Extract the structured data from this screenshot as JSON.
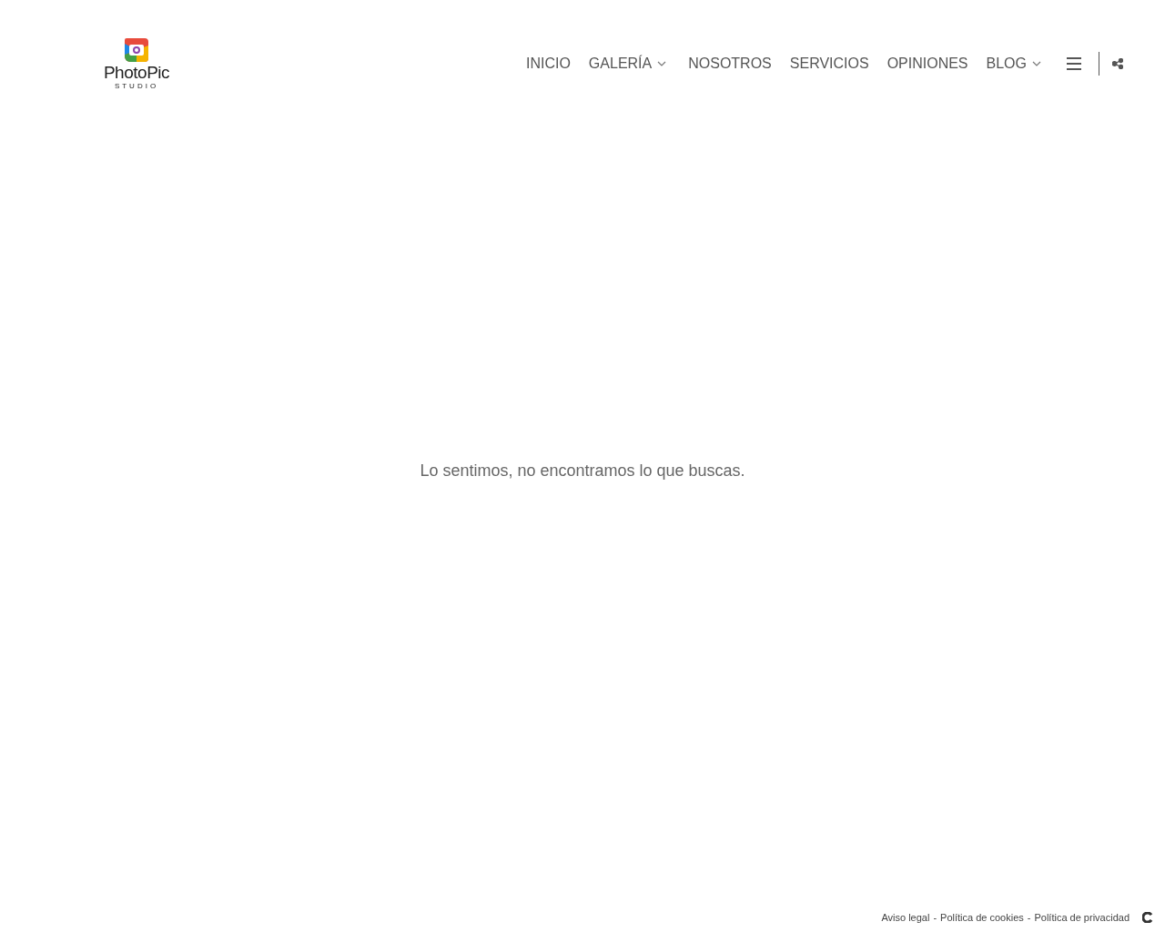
{
  "logo": {
    "name": "PhotoPic",
    "tagline": "STUDIO"
  },
  "nav": [
    {
      "label": "INICIO",
      "dropdown": false
    },
    {
      "label": "GALERÍA",
      "dropdown": true
    },
    {
      "label": "NOSOTROS",
      "dropdown": false
    },
    {
      "label": "SERVICIOS",
      "dropdown": false
    },
    {
      "label": "OPINIONES",
      "dropdown": false
    },
    {
      "label": "BLOG",
      "dropdown": true
    }
  ],
  "message": "Lo sentimos, no encontramos lo que buscas.",
  "footer": {
    "links": [
      "Aviso legal",
      "Política de cookies",
      "Política de privacidad"
    ],
    "separator": "-"
  }
}
